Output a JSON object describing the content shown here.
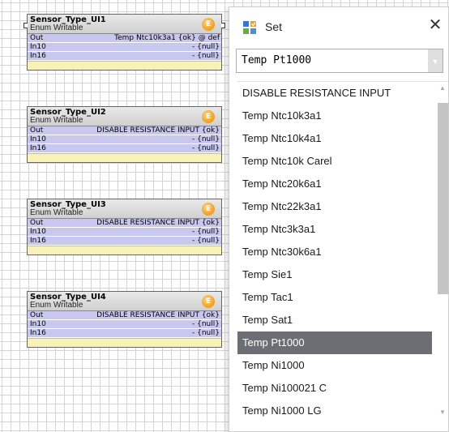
{
  "blocks": [
    {
      "title": "Sensor_Type_UI1",
      "subtitle": "Enum Writable",
      "status_glyph": "E",
      "slots": [
        {
          "name": "Out",
          "value": "Temp Ntc10k3a1 {ok} @ def"
        },
        {
          "name": "In10",
          "value": "- {null}"
        },
        {
          "name": "In16",
          "value": "- {null}"
        }
      ]
    },
    {
      "title": "Sensor_Type_UI2",
      "subtitle": "Enum Writable",
      "status_glyph": "E",
      "slots": [
        {
          "name": "Out",
          "value": "DISABLE RESISTANCE INPUT {ok}"
        },
        {
          "name": "In10",
          "value": "- {null}"
        },
        {
          "name": "In16",
          "value": "- {null}"
        }
      ]
    },
    {
      "title": "Sensor_Type_UI3",
      "subtitle": "Enum Writable",
      "status_glyph": "E",
      "slots": [
        {
          "name": "Out",
          "value": "DISABLE RESISTANCE INPUT {ok}"
        },
        {
          "name": "In10",
          "value": "- {null}"
        },
        {
          "name": "In16",
          "value": "- {null}"
        }
      ]
    },
    {
      "title": "Sensor_Type_UI4",
      "subtitle": "Enum Writable",
      "status_glyph": "E",
      "slots": [
        {
          "name": "Out",
          "value": "DISABLE RESISTANCE INPUT {ok}"
        },
        {
          "name": "In10",
          "value": "- {null}"
        },
        {
          "name": "In16",
          "value": "- {null}"
        }
      ]
    }
  ],
  "dialog": {
    "title": "Set",
    "close_glyph": "✕",
    "combo": {
      "value": "Temp Pt1000",
      "arrow_glyph": "▼"
    },
    "options": [
      "DISABLE RESISTANCE INPUT",
      "Temp Ntc10k3a1",
      "Temp Ntc10k4a1",
      "Temp Ntc10k Carel",
      "Temp Ntc20k6a1",
      "Temp Ntc22k3a1",
      "Temp Ntc3k3a1",
      "Temp Ntc30k6a1",
      "Temp Sie1",
      "Temp Tac1",
      "Temp Sat1",
      "Temp Pt1000",
      "Temp Ni1000",
      "Temp Ni100021 C",
      "Temp Ni1000 LG"
    ],
    "selected_option": "Temp Pt1000",
    "scroll_up_glyph": "▲",
    "scroll_down_glyph": "▼"
  },
  "colors": {
    "slot_background": "#c8c8ef",
    "footer_background": "#f8f2b8",
    "status_dot": "#f2a52a",
    "selected_option_background": "#6b6f73"
  },
  "icons": {
    "dialog": "set-dialog-icon",
    "status": "status-dot-icon",
    "close": "close-icon"
  }
}
